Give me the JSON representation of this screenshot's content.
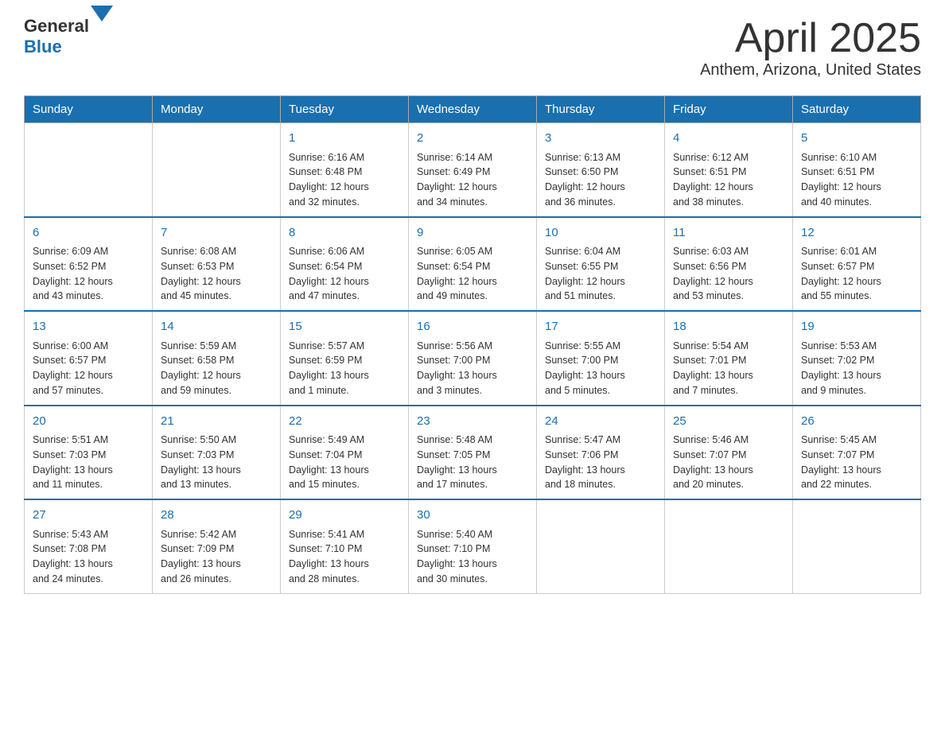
{
  "header": {
    "logo_text1": "General",
    "logo_text2": "Blue",
    "month_title": "April 2025",
    "subtitle": "Anthem, Arizona, United States"
  },
  "days_of_week": [
    "Sunday",
    "Monday",
    "Tuesday",
    "Wednesday",
    "Thursday",
    "Friday",
    "Saturday"
  ],
  "weeks": [
    {
      "days": [
        {
          "num": "",
          "info": ""
        },
        {
          "num": "",
          "info": ""
        },
        {
          "num": "1",
          "info": "Sunrise: 6:16 AM\nSunset: 6:48 PM\nDaylight: 12 hours\nand 32 minutes."
        },
        {
          "num": "2",
          "info": "Sunrise: 6:14 AM\nSunset: 6:49 PM\nDaylight: 12 hours\nand 34 minutes."
        },
        {
          "num": "3",
          "info": "Sunrise: 6:13 AM\nSunset: 6:50 PM\nDaylight: 12 hours\nand 36 minutes."
        },
        {
          "num": "4",
          "info": "Sunrise: 6:12 AM\nSunset: 6:51 PM\nDaylight: 12 hours\nand 38 minutes."
        },
        {
          "num": "5",
          "info": "Sunrise: 6:10 AM\nSunset: 6:51 PM\nDaylight: 12 hours\nand 40 minutes."
        }
      ]
    },
    {
      "days": [
        {
          "num": "6",
          "info": "Sunrise: 6:09 AM\nSunset: 6:52 PM\nDaylight: 12 hours\nand 43 minutes."
        },
        {
          "num": "7",
          "info": "Sunrise: 6:08 AM\nSunset: 6:53 PM\nDaylight: 12 hours\nand 45 minutes."
        },
        {
          "num": "8",
          "info": "Sunrise: 6:06 AM\nSunset: 6:54 PM\nDaylight: 12 hours\nand 47 minutes."
        },
        {
          "num": "9",
          "info": "Sunrise: 6:05 AM\nSunset: 6:54 PM\nDaylight: 12 hours\nand 49 minutes."
        },
        {
          "num": "10",
          "info": "Sunrise: 6:04 AM\nSunset: 6:55 PM\nDaylight: 12 hours\nand 51 minutes."
        },
        {
          "num": "11",
          "info": "Sunrise: 6:03 AM\nSunset: 6:56 PM\nDaylight: 12 hours\nand 53 minutes."
        },
        {
          "num": "12",
          "info": "Sunrise: 6:01 AM\nSunset: 6:57 PM\nDaylight: 12 hours\nand 55 minutes."
        }
      ]
    },
    {
      "days": [
        {
          "num": "13",
          "info": "Sunrise: 6:00 AM\nSunset: 6:57 PM\nDaylight: 12 hours\nand 57 minutes."
        },
        {
          "num": "14",
          "info": "Sunrise: 5:59 AM\nSunset: 6:58 PM\nDaylight: 12 hours\nand 59 minutes."
        },
        {
          "num": "15",
          "info": "Sunrise: 5:57 AM\nSunset: 6:59 PM\nDaylight: 13 hours\nand 1 minute."
        },
        {
          "num": "16",
          "info": "Sunrise: 5:56 AM\nSunset: 7:00 PM\nDaylight: 13 hours\nand 3 minutes."
        },
        {
          "num": "17",
          "info": "Sunrise: 5:55 AM\nSunset: 7:00 PM\nDaylight: 13 hours\nand 5 minutes."
        },
        {
          "num": "18",
          "info": "Sunrise: 5:54 AM\nSunset: 7:01 PM\nDaylight: 13 hours\nand 7 minutes."
        },
        {
          "num": "19",
          "info": "Sunrise: 5:53 AM\nSunset: 7:02 PM\nDaylight: 13 hours\nand 9 minutes."
        }
      ]
    },
    {
      "days": [
        {
          "num": "20",
          "info": "Sunrise: 5:51 AM\nSunset: 7:03 PM\nDaylight: 13 hours\nand 11 minutes."
        },
        {
          "num": "21",
          "info": "Sunrise: 5:50 AM\nSunset: 7:03 PM\nDaylight: 13 hours\nand 13 minutes."
        },
        {
          "num": "22",
          "info": "Sunrise: 5:49 AM\nSunset: 7:04 PM\nDaylight: 13 hours\nand 15 minutes."
        },
        {
          "num": "23",
          "info": "Sunrise: 5:48 AM\nSunset: 7:05 PM\nDaylight: 13 hours\nand 17 minutes."
        },
        {
          "num": "24",
          "info": "Sunrise: 5:47 AM\nSunset: 7:06 PM\nDaylight: 13 hours\nand 18 minutes."
        },
        {
          "num": "25",
          "info": "Sunrise: 5:46 AM\nSunset: 7:07 PM\nDaylight: 13 hours\nand 20 minutes."
        },
        {
          "num": "26",
          "info": "Sunrise: 5:45 AM\nSunset: 7:07 PM\nDaylight: 13 hours\nand 22 minutes."
        }
      ]
    },
    {
      "days": [
        {
          "num": "27",
          "info": "Sunrise: 5:43 AM\nSunset: 7:08 PM\nDaylight: 13 hours\nand 24 minutes."
        },
        {
          "num": "28",
          "info": "Sunrise: 5:42 AM\nSunset: 7:09 PM\nDaylight: 13 hours\nand 26 minutes."
        },
        {
          "num": "29",
          "info": "Sunrise: 5:41 AM\nSunset: 7:10 PM\nDaylight: 13 hours\nand 28 minutes."
        },
        {
          "num": "30",
          "info": "Sunrise: 5:40 AM\nSunset: 7:10 PM\nDaylight: 13 hours\nand 30 minutes."
        },
        {
          "num": "",
          "info": ""
        },
        {
          "num": "",
          "info": ""
        },
        {
          "num": "",
          "info": ""
        }
      ]
    }
  ]
}
